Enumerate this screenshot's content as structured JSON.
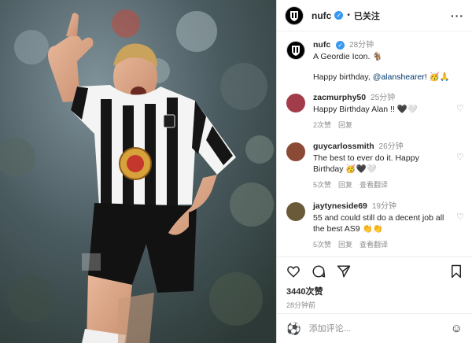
{
  "post": {
    "username": "nufc",
    "follow_label": "已关注",
    "more_icon": "more-horizontal-icon",
    "caption": {
      "time": "28分钟",
      "line1": "A Geordie Icon. 🐐",
      "line2_prefix": "Happy birthday, ",
      "mention": "@alanshearer",
      "line2_suffix": "! 🥳🙏"
    },
    "comments": [
      {
        "username": "zacmurphy50",
        "time": "25分钟",
        "text": "Happy Birthday Alan !! 🖤🤍",
        "likes": "2次赞",
        "reply": "回复",
        "avatar_color": "#a33c4a"
      },
      {
        "username": "guycarlossmith",
        "time": "26分钟",
        "text": "The best to ever do it. Happy Birthday 🥳🖤🤍",
        "likes": "5次赞",
        "reply": "回复",
        "translate": "查看翻译",
        "avatar_color": "#8a4a35"
      },
      {
        "username": "jaytyneside69",
        "time": "19分钟",
        "text": "55 and could still do a decent job all the best AS9 👏👏",
        "likes": "5次赞",
        "reply": "回复",
        "translate": "查看翻译",
        "avatar_color": "#6b5a3a"
      }
    ],
    "likes_count": "3440次赞",
    "posted_ago": "28分钟前",
    "comment_placeholder": "添加评论...",
    "accent": "#3897f0"
  }
}
